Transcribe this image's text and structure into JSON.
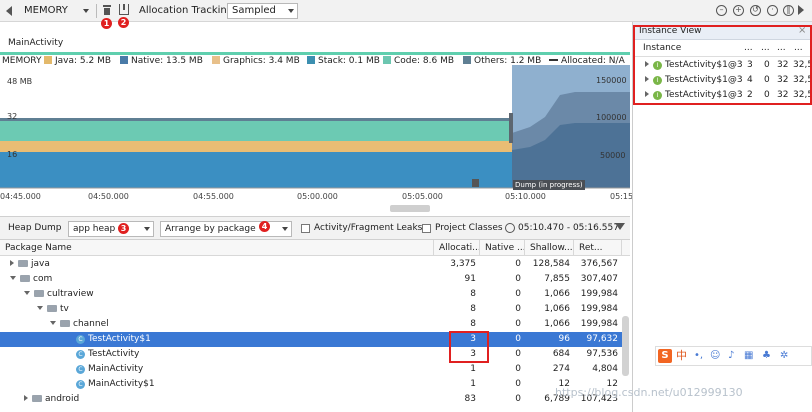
{
  "toolbar": {
    "profiler_label": "MEMORY",
    "allocation_tracking_label": "Allocation Tracking",
    "allocation_mode": "Sampled",
    "markers": [
      "1",
      "2"
    ]
  },
  "activity": "MainActivity",
  "chart_data": {
    "type": "area",
    "title": "MEMORY",
    "legend": [
      {
        "name": "Java: 5.2 MB",
        "color": "#e3b96b"
      },
      {
        "name": "Native: 13.5 MB",
        "color": "#4a7ba8"
      },
      {
        "name": "Graphics: 3.4 MB",
        "color": "#e8c08a"
      },
      {
        "name": "Stack: 0.1 MB",
        "color": "#3c8fb0"
      },
      {
        "name": "Code: 8.6 MB",
        "color": "#6cc6b0"
      },
      {
        "name": "Others: 1.2 MB",
        "color": "#5f7f93"
      },
      {
        "name": "Allocated: N/A",
        "color": "#333333"
      }
    ],
    "y_left_labels": [
      "48 MB",
      "32",
      "16"
    ],
    "y_right_labels": [
      "150000",
      "100000",
      "50000"
    ],
    "x_ticks": [
      "04:45.000",
      "04:50.000",
      "04:55.000",
      "05:00.000",
      "05:05.000",
      "05:10.000",
      "05:15"
    ],
    "annotation": "Dump (in progress)"
  },
  "heap_bar": {
    "label": "Heap Dump",
    "heap": "app heap",
    "arrange": "Arrange by package",
    "activity_leaks": "Activity/Fragment Leaks",
    "project_classes": "Project Classes",
    "range": "05:10.470 - 05:16.557",
    "markers": [
      "3",
      "4"
    ]
  },
  "table": {
    "headers": [
      "Package Name",
      "Allocati...",
      "Native ...",
      "Shallow...",
      "Ret..."
    ],
    "rows": [
      {
        "name": "java",
        "alloc": "3,375",
        "native": "0",
        "shallow": "128,584",
        "retained": "376,567"
      },
      {
        "name": "com",
        "alloc": "91",
        "native": "0",
        "shallow": "7,855",
        "retained": "307,407"
      },
      {
        "name": "cultraview",
        "alloc": "8",
        "native": "0",
        "shallow": "1,066",
        "retained": "199,984"
      },
      {
        "name": "tv",
        "alloc": "8",
        "native": "0",
        "shallow": "1,066",
        "retained": "199,984"
      },
      {
        "name": "channel",
        "alloc": "8",
        "native": "0",
        "shallow": "1,066",
        "retained": "199,984"
      },
      {
        "name": "TestActivity$1",
        "alloc": "3",
        "native": "0",
        "shallow": "96",
        "retained": "97,632"
      },
      {
        "name": "TestActivity",
        "alloc": "3",
        "native": "0",
        "shallow": "684",
        "retained": "97,536"
      },
      {
        "name": "MainActivity",
        "alloc": "1",
        "native": "0",
        "shallow": "274",
        "retained": "4,804"
      },
      {
        "name": "MainActivity$1",
        "alloc": "1",
        "native": "0",
        "shallow": "12",
        "retained": "12"
      },
      {
        "name": "android",
        "alloc": "83",
        "native": "0",
        "shallow": "6,789",
        "retained": "107,423"
      }
    ]
  },
  "instance_view": {
    "title": "Instance View",
    "headers": [
      "Instance",
      "...",
      "...",
      "...",
      "..."
    ],
    "rows": [
      {
        "name": "TestActivity$1@3",
        "c1": "3",
        "c2": "0",
        "c3": "32",
        "c4": "32,5"
      },
      {
        "name": "TestActivity$1@3",
        "c1": "4",
        "c2": "0",
        "c3": "32",
        "c4": "32,5"
      },
      {
        "name": "TestActivity$1@3",
        "c1": "2",
        "c2": "0",
        "c3": "32",
        "c4": "32,5"
      }
    ]
  },
  "watermark": "https://blog.csdn.net/u012999130",
  "ime_label": "中"
}
